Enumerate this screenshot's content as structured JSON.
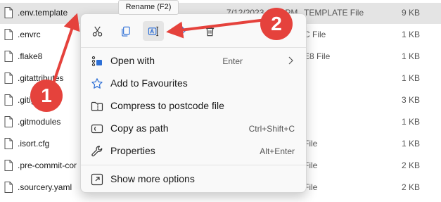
{
  "files": [
    {
      "name": ".env.template",
      "date": "7/12/2023 6:20 PM",
      "type": "TEMPLATE File",
      "size": "9 KB",
      "selected": true
    },
    {
      "name": ".envrc",
      "date": "",
      "type": "C File",
      "size": "1 KB"
    },
    {
      "name": ".flake8",
      "date": "",
      "type": "E8 File",
      "size": "1 KB"
    },
    {
      "name": ".gitattributes",
      "date": "",
      "type": "",
      "size": "1 KB"
    },
    {
      "name": ".gitig",
      "date": "",
      "type": "",
      "size": "3 KB"
    },
    {
      "name": ".gitmodules",
      "date": "",
      "type": "",
      "size": "1 KB"
    },
    {
      "name": ".isort.cfg",
      "date": "",
      "type": "File",
      "size": "1 KB"
    },
    {
      "name": ".pre-commit-cor",
      "date": "",
      "type": "File",
      "size": "2 KB"
    },
    {
      "name": ".sourcery.yaml",
      "date": "",
      "type": "File",
      "size": "2 KB"
    }
  ],
  "tooltip": {
    "text": "Rename (F2)"
  },
  "context_menu": {
    "toolbar": [
      {
        "name": "cut-button",
        "icon": "scissors-icon"
      },
      {
        "name": "copy-button",
        "icon": "copy-icon"
      },
      {
        "name": "rename-button",
        "icon": "rename-icon"
      },
      {
        "name": "share-button",
        "icon": "share-icon"
      },
      {
        "name": "delete-button",
        "icon": "trash-icon"
      }
    ],
    "items": [
      {
        "label": "Open with",
        "shortcut": "Enter",
        "icon": "open-with-icon",
        "submenu": true
      },
      {
        "label": "Add to Favourites",
        "shortcut": "",
        "icon": "star-icon"
      },
      {
        "label": "Compress to postcode file",
        "shortcut": "",
        "icon": "zip-folder-icon"
      },
      {
        "label": "Copy as path",
        "shortcut": "Ctrl+Shift+C",
        "icon": "copy-path-icon"
      },
      {
        "label": "Properties",
        "shortcut": "Alt+Enter",
        "icon": "wrench-icon"
      },
      {
        "label": "Show more options",
        "shortcut": "",
        "icon": "more-options-icon"
      }
    ]
  },
  "annotations": {
    "badge_1": "1",
    "badge_2": "2",
    "color": "#e5423c"
  }
}
